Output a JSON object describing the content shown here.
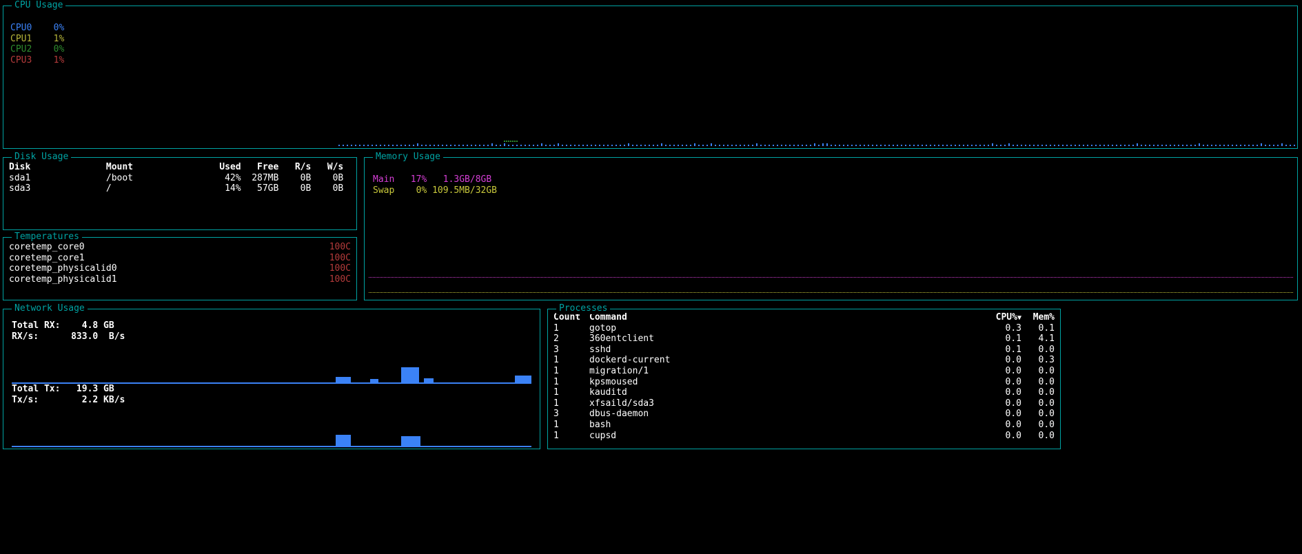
{
  "cpu": {
    "title": "CPU Usage",
    "cores": [
      {
        "label": "CPU0",
        "value": "0%",
        "class": "cpu-blue"
      },
      {
        "label": "CPU1",
        "value": "1%",
        "class": "cpu-olive"
      },
      {
        "label": "CPU2",
        "value": "0%",
        "class": "cpu-green"
      },
      {
        "label": "CPU3",
        "value": "1%",
        "class": "cpu-red"
      }
    ]
  },
  "disk": {
    "title": "Disk Usage",
    "headers": {
      "disk": "Disk",
      "mount": "Mount",
      "used": "Used",
      "free": "Free",
      "rs": "R/s",
      "ws": "W/s"
    },
    "rows": [
      {
        "disk": "sda1",
        "mount": "/boot",
        "used": "42%",
        "free": "287MB",
        "rs": "0B",
        "ws": "0B"
      },
      {
        "disk": "sda3",
        "mount": "/",
        "used": "14%",
        "free": "57GB",
        "rs": "0B",
        "ws": "0B"
      }
    ]
  },
  "temp": {
    "title": "Temperatures",
    "rows": [
      {
        "name": "coretemp_core0",
        "value": "100C"
      },
      {
        "name": "coretemp_core1",
        "value": "100C"
      },
      {
        "name": "coretemp_physicalid0",
        "value": "100C"
      },
      {
        "name": "coretemp_physicalid1",
        "value": "100C"
      }
    ]
  },
  "mem": {
    "title": "Memory Usage",
    "main": {
      "label": "Main",
      "pct": "17%",
      "detail": "1.3GB/8GB"
    },
    "swap": {
      "label": "Swap",
      "pct": "0%",
      "detail": "109.5MB/32GB"
    }
  },
  "net": {
    "title": "Network Usage",
    "rx_total_label": "Total RX:",
    "rx_total_value": "4.8 GB",
    "rx_rate_label": "RX/s:",
    "rx_rate_value": "833.0  B/s",
    "tx_total_label": "Total Tx:",
    "tx_total_value": "19.3 GB",
    "tx_rate_label": "Tx/s:",
    "tx_rate_value": "2.2 KB/s"
  },
  "proc": {
    "title": "Processes",
    "headers": {
      "count": "Count",
      "command": "Command",
      "cpu": "CPU%",
      "mem": "Mem%"
    },
    "sort_indicator": "▼",
    "rows": [
      {
        "count": "1",
        "command": "gotop",
        "cpu": "0.3",
        "mem": "0.1"
      },
      {
        "count": "2",
        "command": "360entclient",
        "cpu": "0.1",
        "mem": "4.1"
      },
      {
        "count": "3",
        "command": "sshd",
        "cpu": "0.1",
        "mem": "0.0"
      },
      {
        "count": "1",
        "command": "dockerd-current",
        "cpu": "0.0",
        "mem": "0.3"
      },
      {
        "count": "1",
        "command": "migration/1",
        "cpu": "0.0",
        "mem": "0.0"
      },
      {
        "count": "1",
        "command": "kpsmoused",
        "cpu": "0.0",
        "mem": "0.0"
      },
      {
        "count": "1",
        "command": "kauditd",
        "cpu": "0.0",
        "mem": "0.0"
      },
      {
        "count": "1",
        "command": "xfsaild/sda3",
        "cpu": "0.0",
        "mem": "0.0"
      },
      {
        "count": "3",
        "command": "dbus-daemon",
        "cpu": "0.0",
        "mem": "0.0"
      },
      {
        "count": "1",
        "command": "bash",
        "cpu": "0.0",
        "mem": "0.0"
      },
      {
        "count": "1",
        "command": "cupsd",
        "cpu": "0.0",
        "mem": "0.0"
      }
    ]
  },
  "chart_data": [
    {
      "type": "line",
      "title": "CPU Usage",
      "ylabel": "%",
      "ylim": [
        0,
        100
      ],
      "series": [
        {
          "name": "CPU0",
          "value": 0
        },
        {
          "name": "CPU1",
          "value": 1
        },
        {
          "name": "CPU2",
          "value": 0
        },
        {
          "name": "CPU3",
          "value": 1
        }
      ]
    },
    {
      "type": "line",
      "title": "Memory Usage",
      "ylabel": "%",
      "ylim": [
        0,
        100
      ],
      "series": [
        {
          "name": "Main",
          "value": 17
        },
        {
          "name": "Swap",
          "value": 0
        }
      ]
    },
    {
      "type": "area",
      "title": "Network RX",
      "ylabel": "B/s",
      "latest": 833.0,
      "total": "4.8 GB"
    },
    {
      "type": "area",
      "title": "Network TX",
      "ylabel": "KB/s",
      "latest": 2.2,
      "total": "19.3 GB"
    }
  ]
}
